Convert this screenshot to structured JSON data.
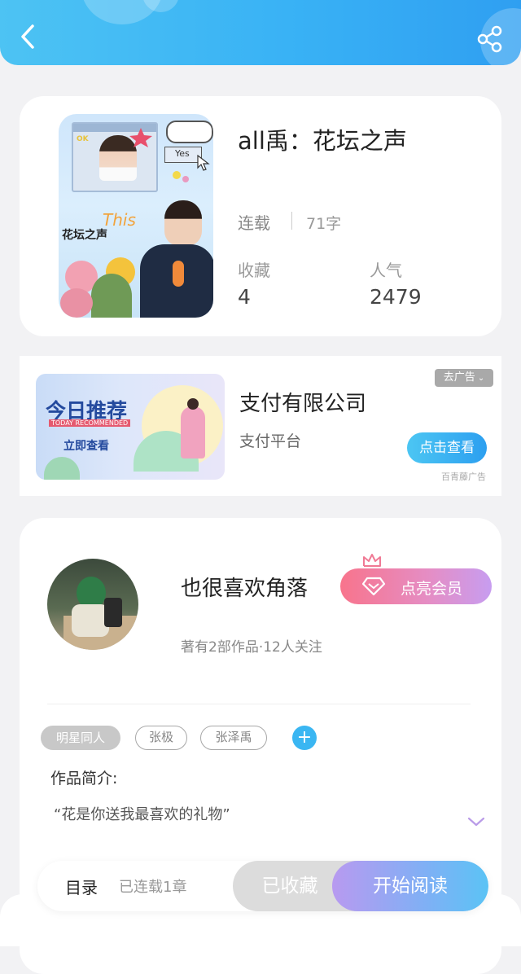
{
  "header": {
    "back_icon": "chevron-left-icon",
    "share_icon": "share-icon"
  },
  "book": {
    "title": "all禹：花坛之声",
    "status": "连载",
    "word_count": "71字",
    "favorites_label": "收藏",
    "favorites_value": "4",
    "popularity_label": "人气",
    "popularity_value": "2479",
    "cover": {
      "title_text": "花坛之声",
      "this_text": "This",
      "yes_text": "Yes",
      "ok_text": "OK"
    }
  },
  "ad": {
    "badge": "去广告",
    "banner_title": "今日推荐",
    "banner_subtitle": "TODAY RECOMMENDED",
    "banner_button": "立即查看",
    "title": "支付有限公司",
    "subtitle": "支付平台",
    "cta": "点击查看",
    "source": "百青藤广告"
  },
  "author": {
    "name": "也很喜欢角落",
    "vip_button": "点亮会员",
    "meta": "著有2部作品·12人关注",
    "tags": [
      "明星同人",
      "张极",
      "张泽禹"
    ],
    "tag_add": "+"
  },
  "intro": {
    "label": "作品简介:",
    "text": "“花是你送我最喜欢的礼物”"
  },
  "bottom_bar": {
    "toc_label": "目录",
    "toc_sub": "已连载1章",
    "favorited": "已收藏",
    "start_reading": "开始阅读"
  },
  "colors": {
    "header_blue": "#39b2f5",
    "accent_blue": "#3ab6f2",
    "vip_pink": "#f8748c",
    "read_purple": "#b89af0"
  }
}
